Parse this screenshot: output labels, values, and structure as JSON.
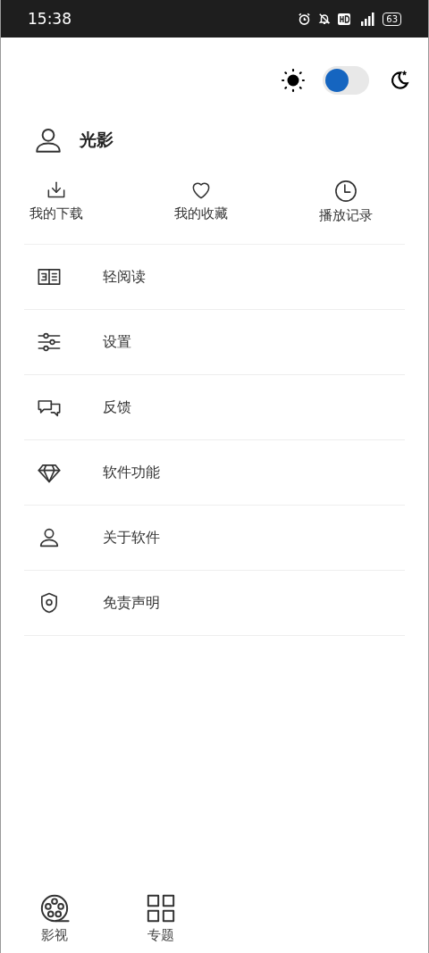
{
  "status_bar": {
    "time": "15:38",
    "battery": "63"
  },
  "theme_toggle": {
    "on": false
  },
  "profile": {
    "name": "光影"
  },
  "quick_actions": [
    {
      "label": "我的下载"
    },
    {
      "label": "我的收藏"
    },
    {
      "label": "播放记录"
    }
  ],
  "menu": [
    {
      "label": "轻阅读"
    },
    {
      "label": "设置"
    },
    {
      "label": "反馈"
    },
    {
      "label": "软件功能"
    },
    {
      "label": "关于软件"
    },
    {
      "label": "免责声明"
    }
  ],
  "bottom_nav": [
    {
      "label": "影视"
    },
    {
      "label": "专题"
    }
  ]
}
